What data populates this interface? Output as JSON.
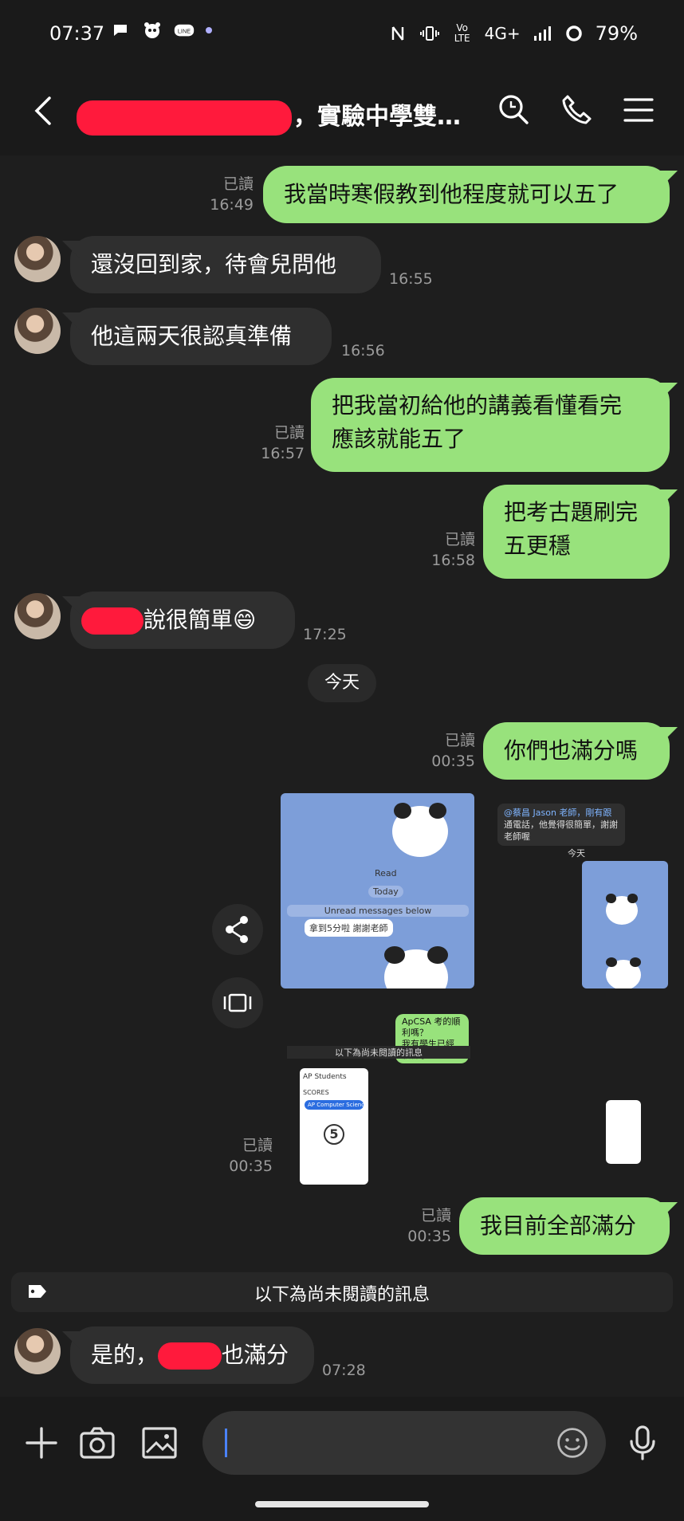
{
  "status_bar": {
    "time": "07:37",
    "network": "4G+",
    "volte": "Vo LTE",
    "battery": "79%",
    "icons": [
      "chat-icon",
      "panda-icon",
      "line-icon",
      "nfc-icon",
      "vibrate-icon",
      "signal-icon",
      "battery-icon"
    ]
  },
  "header": {
    "title_visible": "，實驗中學雙…",
    "icons": [
      "back-icon",
      "search-icon",
      "phone-icon",
      "menu-icon"
    ]
  },
  "messages": [
    {
      "dir": "out",
      "text": "我當時寒假教到他程度就可以五了",
      "read": "已讀",
      "time": "16:49"
    },
    {
      "dir": "in",
      "text": "還沒回到家，待會兒問他",
      "time": "16:55"
    },
    {
      "dir": "in",
      "text": "他這兩天很認真準備",
      "time": "16:56"
    },
    {
      "dir": "out",
      "text_line1": "把我當初給他的講義看懂看完",
      "text_line2": "應該就能五了",
      "read": "已讀",
      "time": "16:57"
    },
    {
      "dir": "out",
      "text_line1": "把考古題刷完",
      "text_line2": "五更穩",
      "read": "已讀",
      "time": "16:58"
    },
    {
      "dir": "in",
      "text_after_redaction": "說很簡單😄",
      "time": "17:25"
    },
    {
      "dir": "out",
      "text": "你們也滿分嗎",
      "read": "已讀",
      "time": "00:35"
    },
    {
      "dir": "out",
      "type": "images",
      "read": "已讀",
      "time": "00:35"
    },
    {
      "dir": "out",
      "text": "我目前全部滿分",
      "read": "已讀",
      "time": "00:35"
    },
    {
      "dir": "in",
      "text_before_redaction": "是的，",
      "text_after_redaction": "也滿分",
      "time": "07:28"
    }
  ],
  "date_divider": "今天",
  "unread_divider": "以下為尚未閱讀的訊息",
  "screenshot_thumbs": {
    "a_reply": "拿到5分啦 謝謝老師",
    "a_sub": "Read",
    "a_today": "Today",
    "a_unread": "Unread messages below",
    "green_reply": "ApCSA 考的順利嗎？\n我有學生已經放榜了",
    "header_mention": "@蔡昌 Jason 老師，剛有跟",
    "header_line2": "通電話，他覺得很簡單，謝謝老師喔",
    "today": "今天",
    "unread": "以下為尚未閱讀的訊息",
    "score_title": "AP Students",
    "score_label": "SCORES",
    "score_value": "5",
    "score_badge": "AP Computer Science A"
  },
  "input": {
    "placeholder": "",
    "icons": [
      "plus-icon",
      "camera-icon",
      "image-icon",
      "emoji-icon",
      "mic-icon"
    ]
  },
  "colors": {
    "outgoing_bubble": "#98e27c",
    "incoming_bubble": "#2f2f2f",
    "background": "#1e1e1e",
    "redaction": "#ff1a3c"
  }
}
